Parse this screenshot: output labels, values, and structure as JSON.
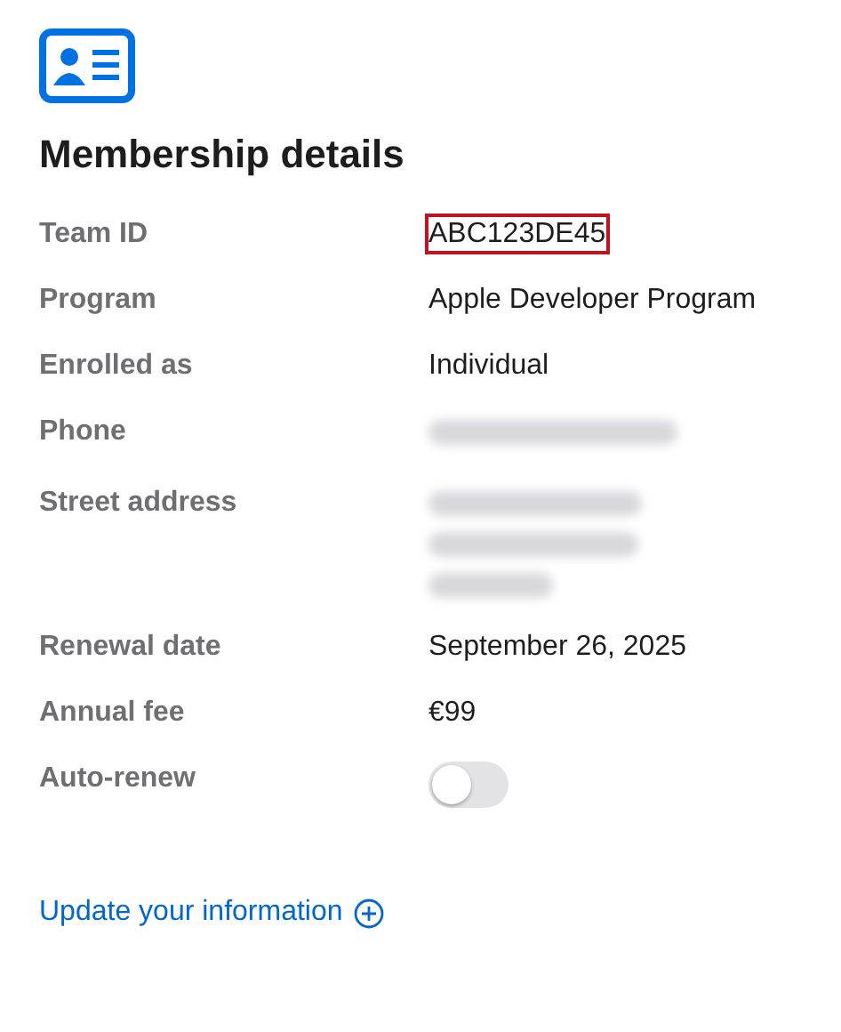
{
  "title": "Membership details",
  "rows": [
    {
      "label": "Team ID",
      "kind": "text",
      "value": "ABC123DE45",
      "highlighted": true
    },
    {
      "label": "Program",
      "kind": "text",
      "value": "Apple Developer Program",
      "highlighted": false
    },
    {
      "label": "Enrolled as",
      "kind": "text",
      "value": "Individual",
      "highlighted": false
    },
    {
      "label": "Phone",
      "kind": "redacted",
      "multiline": false
    },
    {
      "label": "Street address",
      "kind": "redacted",
      "multiline": true
    },
    {
      "label": "Renewal date",
      "kind": "text",
      "value": "September 26, 2025",
      "highlighted": false
    },
    {
      "label": "Annual fee",
      "kind": "text",
      "value": "€99",
      "highlighted": false
    },
    {
      "label": "Auto-renew",
      "kind": "toggle",
      "on": false
    }
  ],
  "link": {
    "label": "Update your information"
  }
}
